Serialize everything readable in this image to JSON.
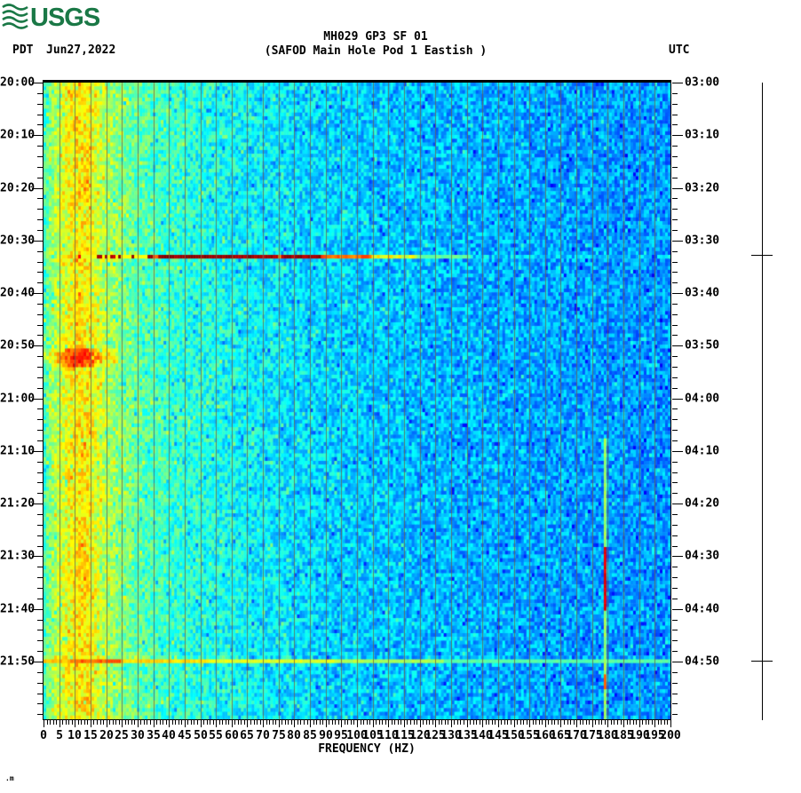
{
  "logo": {
    "text": "USGS",
    "icon": "usgs-wave-icon",
    "color": "#1a7846"
  },
  "header": {
    "timezone_left": "PDT",
    "date": "Jun27,2022",
    "title_line1": "MH029 GP3 SF 01",
    "title_line2": "(SAFOD Main Hole Pod 1 Eastish )",
    "timezone_right": "UTC"
  },
  "corner_mark": ".m",
  "colors": {
    "usgs_green": "#1a7846",
    "axis": "#000000",
    "grid_line": "#69644e",
    "background": "#ffffff"
  },
  "chart_data": {
    "type": "heatmap",
    "subtype": "spectrogram",
    "title": "MH029 GP3 SF 01",
    "subtitle": "(SAFOD Main Hole Pod 1 Eastish )",
    "xlabel": "FREQUENCY (HZ)",
    "x_unit": "Hz",
    "x_range": [
      0,
      200
    ],
    "x_major_tick_step": 5,
    "x_minor_tick_step": 1,
    "colormap": "jet",
    "grid": "vertical gray lines every 5 Hz",
    "legend_position": "none",
    "y_left": {
      "timezone": "PDT",
      "date": "Jun27,2022",
      "start": "20:00",
      "end_of_plot": "22:01",
      "label_interval_min": 10,
      "minor_tick_min": 2,
      "tick_labels": [
        "20:00",
        "20:10",
        "20:20",
        "20:30",
        "20:40",
        "20:50",
        "21:00",
        "21:10",
        "21:20",
        "21:30",
        "21:40",
        "21:50"
      ]
    },
    "y_right": {
      "timezone": "UTC",
      "label_interval_min": 10,
      "minor_tick_min": 2,
      "tick_labels": [
        "03:00",
        "03:10",
        "03:20",
        "03:30",
        "03:40",
        "03:50",
        "04:00",
        "04:10",
        "04:20",
        "04:30",
        "04:40",
        "04:50"
      ]
    },
    "background_field": "blue low-amplitude noise, grading from cyan ~30-60 Hz to deeper blue toward 200 Hz",
    "features": [
      {
        "name": "persistent-low-frequency-band",
        "freq_hz": [
          3,
          25
        ],
        "time_extent": "entire record",
        "peak_freq_hz": [
          9,
          15
        ],
        "intensity": "yellow-green, strongest yellow near 10-14 Hz"
      },
      {
        "name": "broadband-event-streak-1",
        "time_pdt": "20:32",
        "time_utc": "03:32",
        "freq_hz": [
          12,
          135
        ],
        "intensity": "dark red (saturated) 34-90 Hz, orange-yellow 90-118 Hz, intermittent red blips 12-33 Hz"
      },
      {
        "name": "low-frequency-burst",
        "time_pdt": "20:51-20:53",
        "freq_hz": [
          1,
          22
        ],
        "intensity": "yellow-orange with small red pixels near 11-15 Hz"
      },
      {
        "name": "broadband-event-streak-2",
        "time_pdt": "21:49",
        "time_utc": "04:49",
        "freq_hz": [
          1,
          200
        ],
        "intensity": "orange 8-24 Hz, yellow to ~90 Hz, fading to light cyan band to 200 Hz"
      },
      {
        "name": "narrowband-tone",
        "freq_hz": 178.5,
        "time_pdt_extent": [
          "21:22",
          "22:00"
        ],
        "intensity": "yellow-green line with bright red segment ~21:28-21:38 and orange blip ~21:53"
      }
    ],
    "event_markers": [
      {
        "axis": "UTC",
        "time": "03:32",
        "mark": "scale-bar-cross"
      },
      {
        "axis": "UTC",
        "time": "04:48",
        "mark": "scale-bar-cross"
      }
    ]
  }
}
